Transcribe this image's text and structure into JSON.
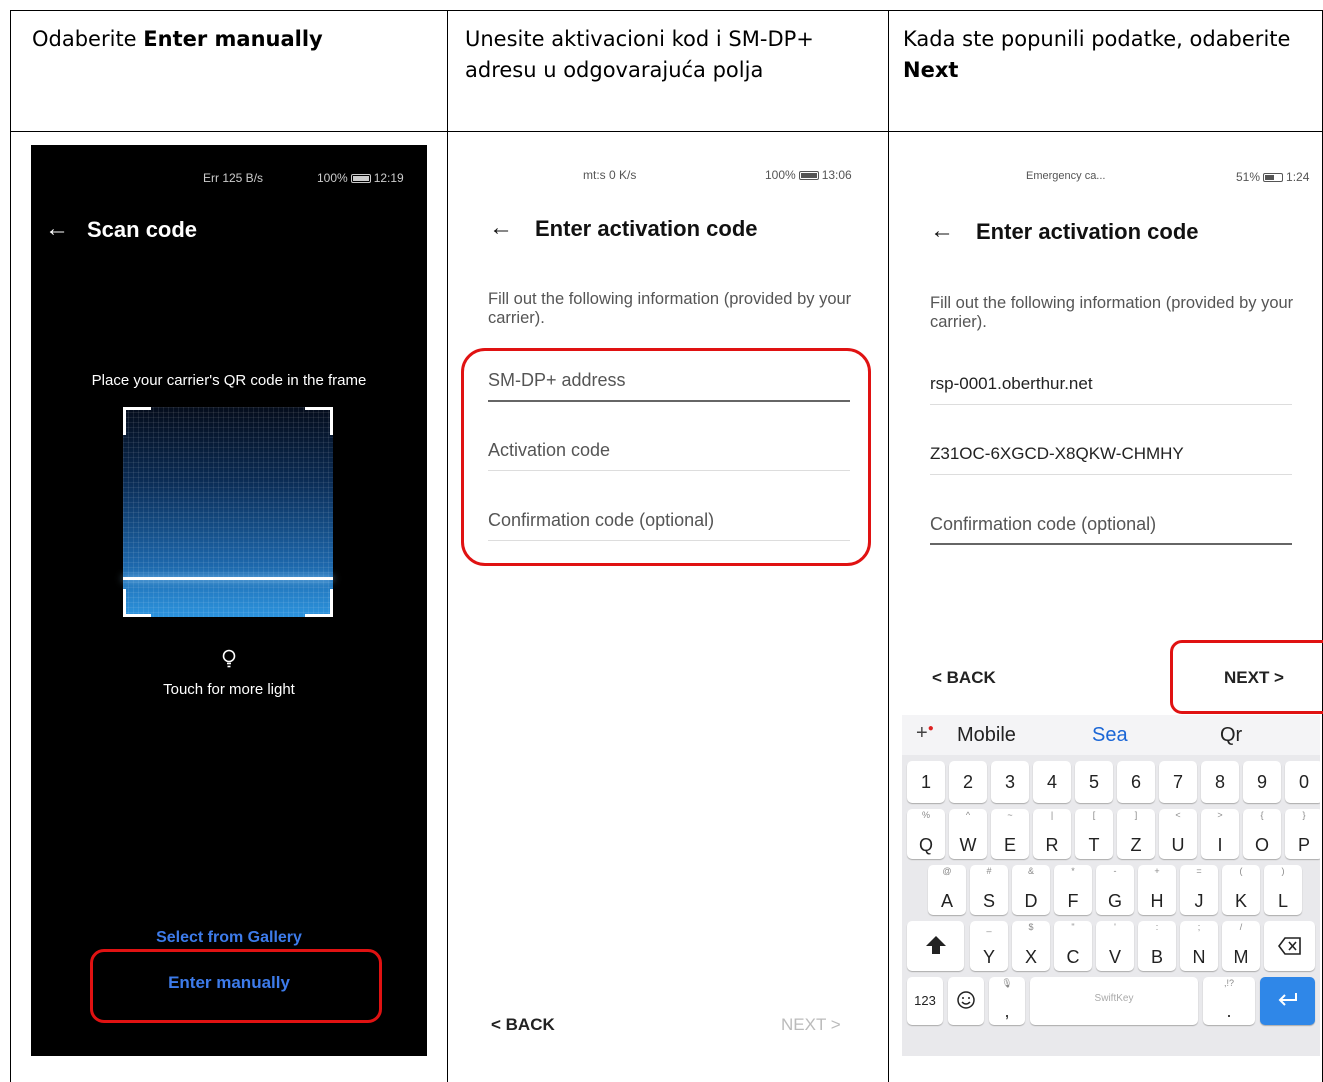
{
  "headers": [
    {
      "pre": "Odaberite ",
      "bold": "Enter manually",
      "post": ""
    },
    {
      "pre": "Unesite aktivacioni kod i SM-DP+ adresu u odgovarajuća polja",
      "bold": "",
      "post": ""
    },
    {
      "pre": "Kada ste popunili podatke, odaberite ",
      "bold": "Next",
      "post": ""
    }
  ],
  "phone1": {
    "status_left": "Err 125 B/s",
    "status_right": "100%",
    "time": "12:19",
    "title": "Scan code",
    "instruction": "Place your carrier's QR code in the frame",
    "light_label": "Touch for more light",
    "gallery_link": "Select from Gallery",
    "enter_manually": "Enter manually"
  },
  "phone2": {
    "status_left": "mt:s 0 K/s",
    "status_right": "100%",
    "time": "13:06",
    "title": "Enter activation code",
    "description": "Fill out the following information (provided by your carrier).",
    "field_smdp": "SM-DP+ address",
    "field_activation": "Activation code",
    "field_confirmation": "Confirmation code (optional)",
    "back": "< BACK",
    "next": "NEXT >"
  },
  "phone3": {
    "status_left": "Emergency ca...",
    "status_right": "51%",
    "time": "1:24",
    "title": "Enter activation code",
    "description": "Fill out the following information (provided by your carrier).",
    "smdp_value": "rsp-0001.oberthur.net",
    "activation_value": "Z31OC-6XGCD-X8QKW-CHMHY",
    "field_confirmation": "Confirmation code (optional)",
    "back": "< BACK",
    "next": "NEXT >",
    "keyboard": {
      "suggestions": [
        "Mobile",
        "Sea",
        "Qr"
      ],
      "numbers": [
        "1",
        "2",
        "3",
        "4",
        "5",
        "6",
        "7",
        "8",
        "9",
        "0"
      ],
      "row1": [
        [
          "%",
          "Q"
        ],
        [
          "^",
          "W"
        ],
        [
          "~",
          "E"
        ],
        [
          "|",
          "R"
        ],
        [
          "[",
          "T"
        ],
        [
          "]",
          "Z"
        ],
        [
          "<",
          "U"
        ],
        [
          ">",
          "I"
        ],
        [
          "{",
          "O"
        ],
        [
          "}",
          "P"
        ]
      ],
      "row2": [
        [
          "@",
          "A"
        ],
        [
          "#",
          "S"
        ],
        [
          "&",
          "D"
        ],
        [
          "*",
          "F"
        ],
        [
          "-",
          "G"
        ],
        [
          "+",
          "H"
        ],
        [
          "=",
          "J"
        ],
        [
          "(",
          "K"
        ],
        [
          ")",
          "L"
        ]
      ],
      "row3": [
        [
          "_",
          "Y"
        ],
        [
          "$",
          "X"
        ],
        [
          "\"",
          "C"
        ],
        [
          "'",
          "V"
        ],
        [
          ":",
          "B"
        ],
        [
          ";",
          "N"
        ],
        [
          "/",
          "M"
        ]
      ],
      "num_key": "123",
      "comma": ",",
      "space_brand": "SwiftKey",
      "period": ".",
      "period_sup": ",!?"
    }
  },
  "colors": {
    "highlight_red": "#e01212",
    "link_blue": "#3d7bea",
    "accent_blue": "#1a66d6",
    "enter_blue": "#2f87e8"
  }
}
